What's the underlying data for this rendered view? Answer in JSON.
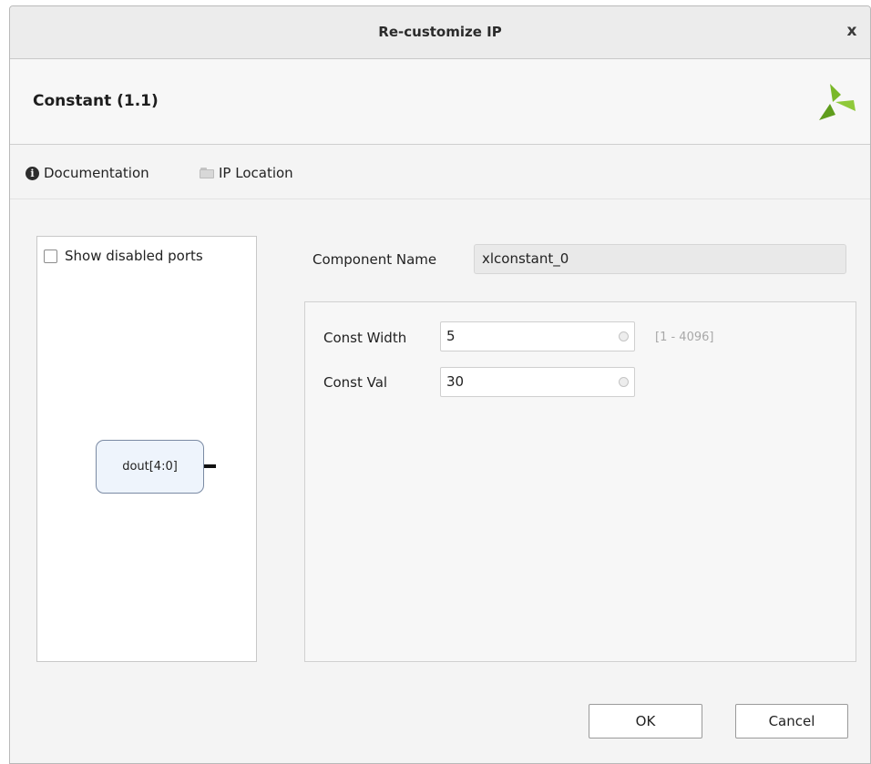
{
  "window": {
    "title": "Re-customize IP",
    "close_glyph": "x"
  },
  "header": {
    "ip_title": "Constant (1.1)",
    "logo_icon": "xilinx-logo-icon"
  },
  "toolbar": {
    "documentation_label": "Documentation",
    "ip_location_label": "IP Location",
    "documentation_icon": "info-icon",
    "ip_location_icon": "folder-icon"
  },
  "symbol_panel": {
    "show_disabled_ports_label": "Show disabled ports",
    "show_disabled_ports_checked": false,
    "port_label": "dout[4:0]"
  },
  "component": {
    "label": "Component Name",
    "value": "xlconstant_0"
  },
  "params": {
    "const_width_label": "Const Width",
    "const_width_value": "5",
    "const_width_range": "[1 - 4096]",
    "const_val_label": "Const Val",
    "const_val_value": "30"
  },
  "buttons": {
    "ok_label": "OK",
    "cancel_label": "Cancel"
  },
  "colors": {
    "port_fill": "#eef4fc",
    "logo_green": "#7ab828"
  }
}
